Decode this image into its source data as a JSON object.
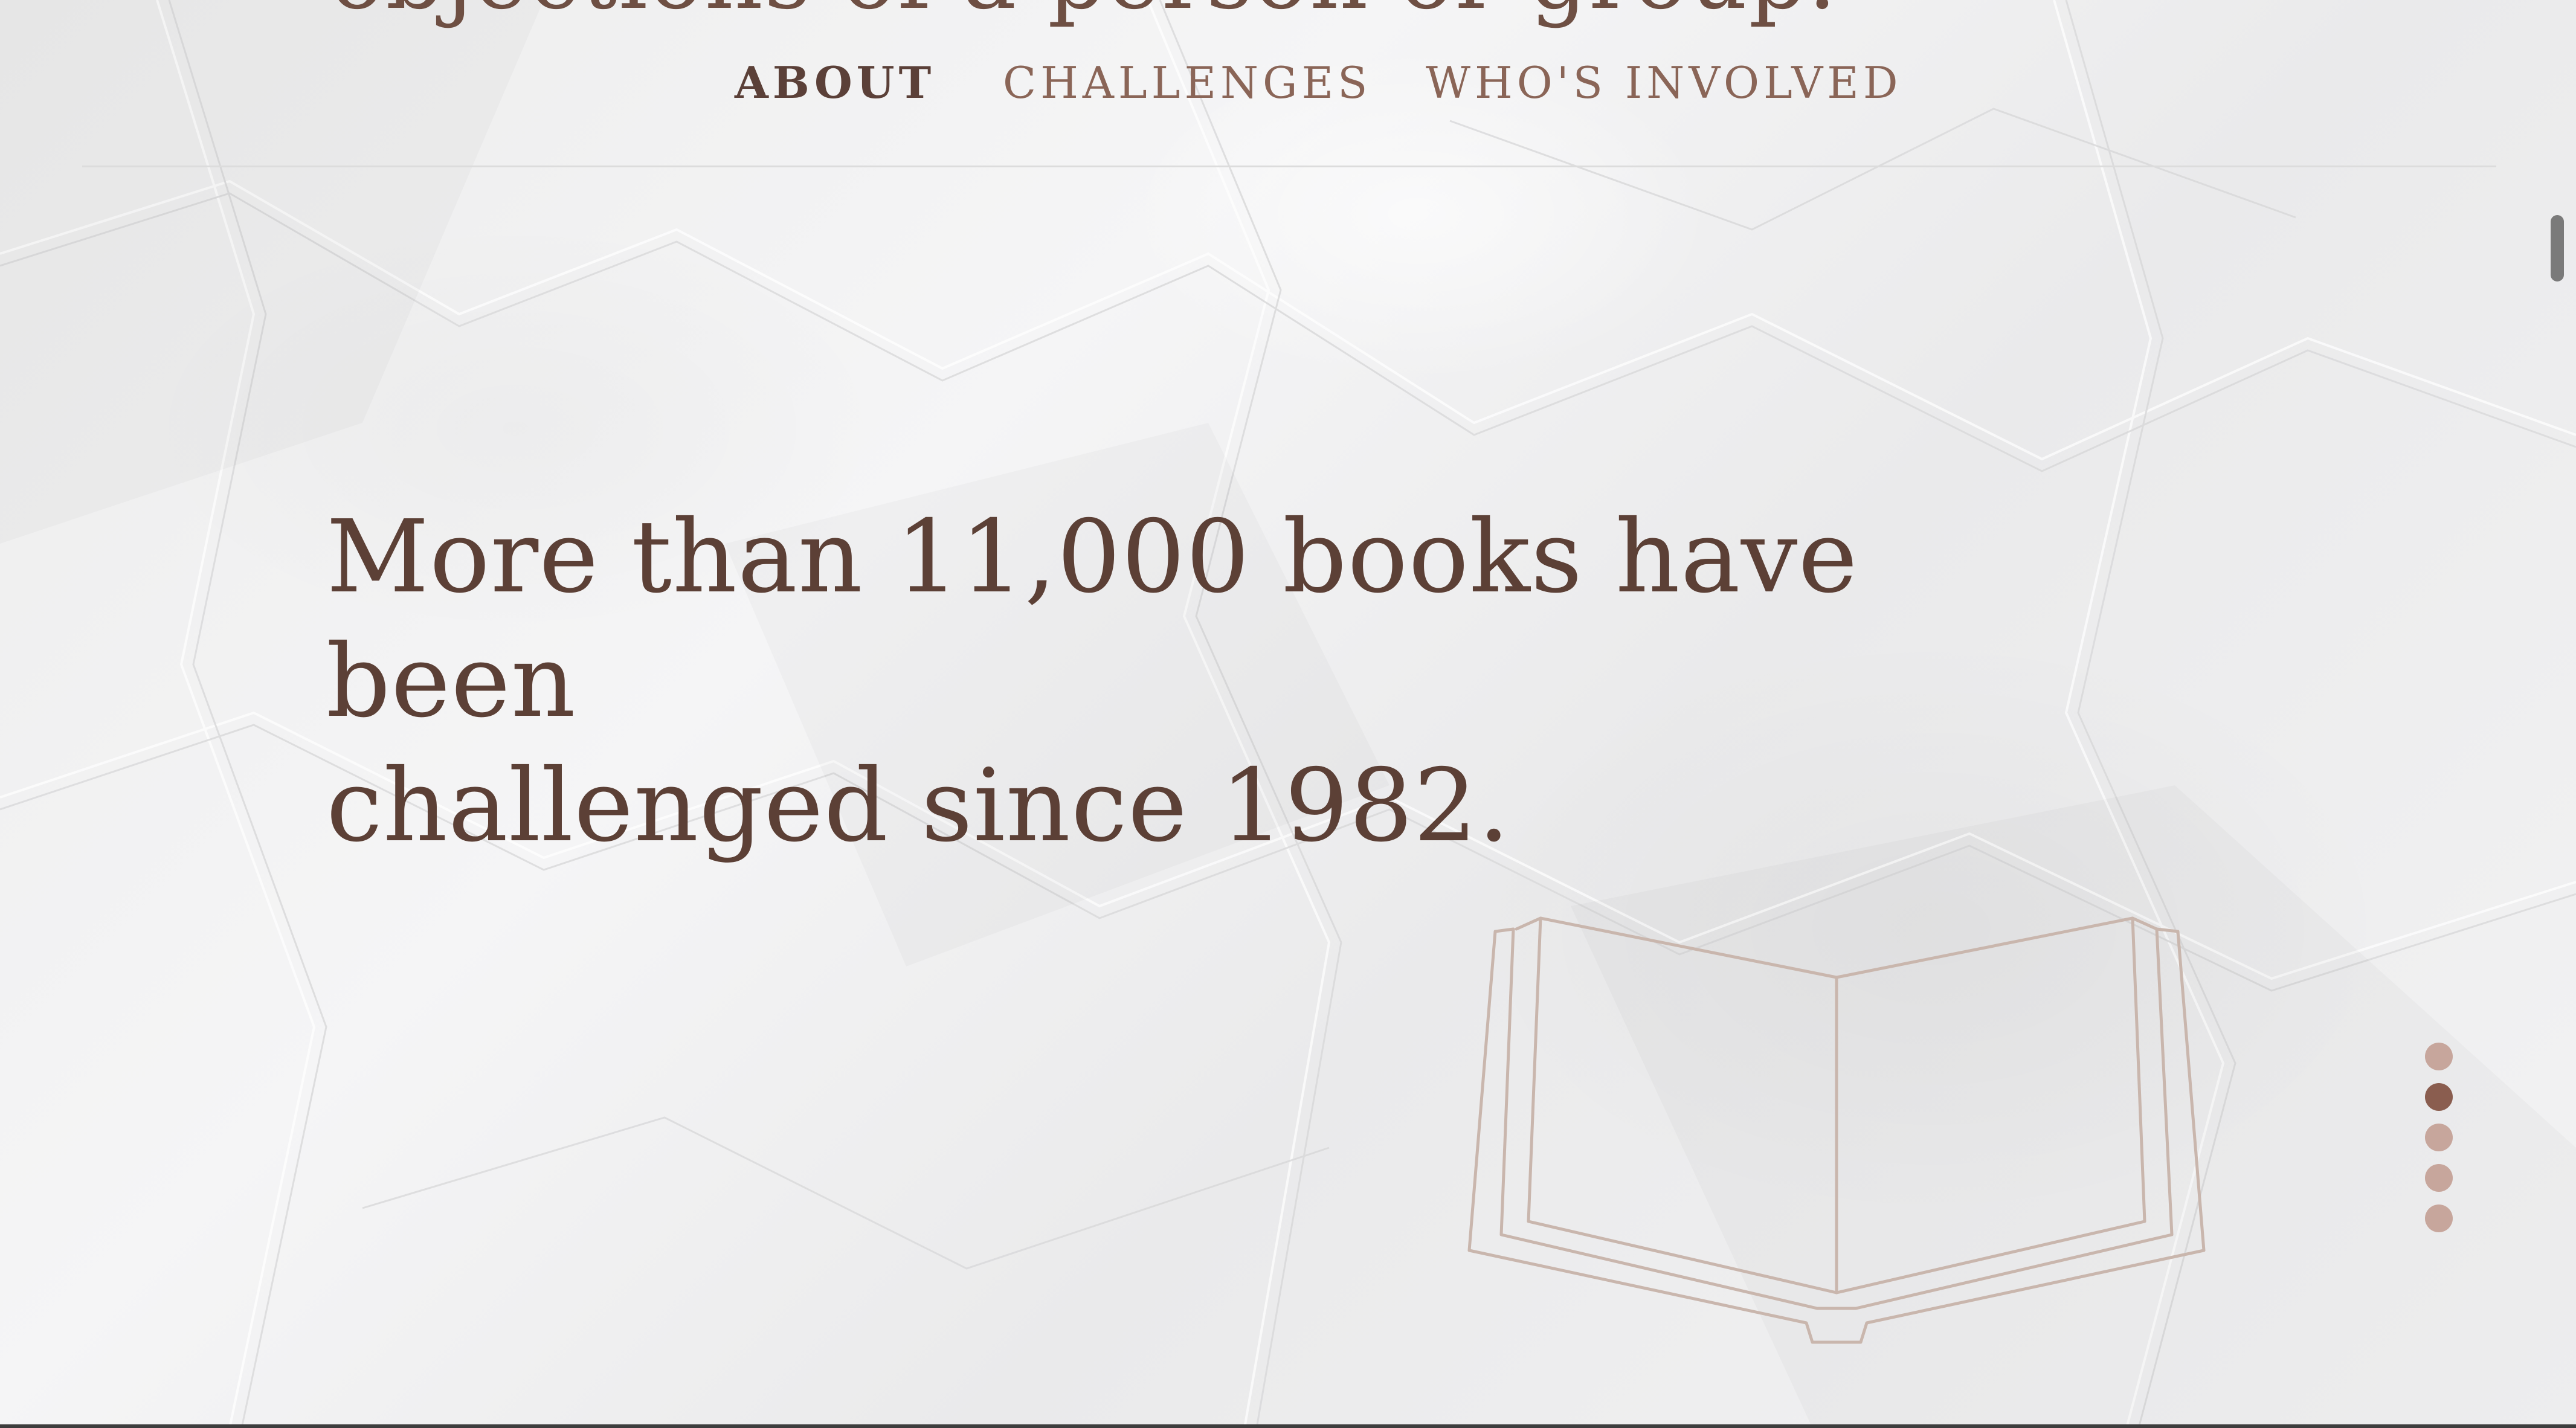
{
  "hero": {
    "heading_partial": "objections of a person or group."
  },
  "nav": {
    "items": [
      {
        "label": "ABOUT",
        "active": true
      },
      {
        "label": "CHALLENGES",
        "active": false
      },
      {
        "label": "WHO'S INVOLVED",
        "active": false
      }
    ]
  },
  "section": {
    "statement_line1": "More than 11,000 books have been",
    "statement_line2": "challenged since 1982."
  },
  "illustration": {
    "icon": "open-book-icon"
  },
  "pager": {
    "count": 5,
    "active_index": 1
  },
  "colors": {
    "text_dark": "#5c4036",
    "nav_text": "#8a6557",
    "dot_inactive": "#c7a69c",
    "dot_active": "#8a5d4f",
    "book_stroke": "#c9b6ad",
    "paper": "#eeeeef"
  }
}
